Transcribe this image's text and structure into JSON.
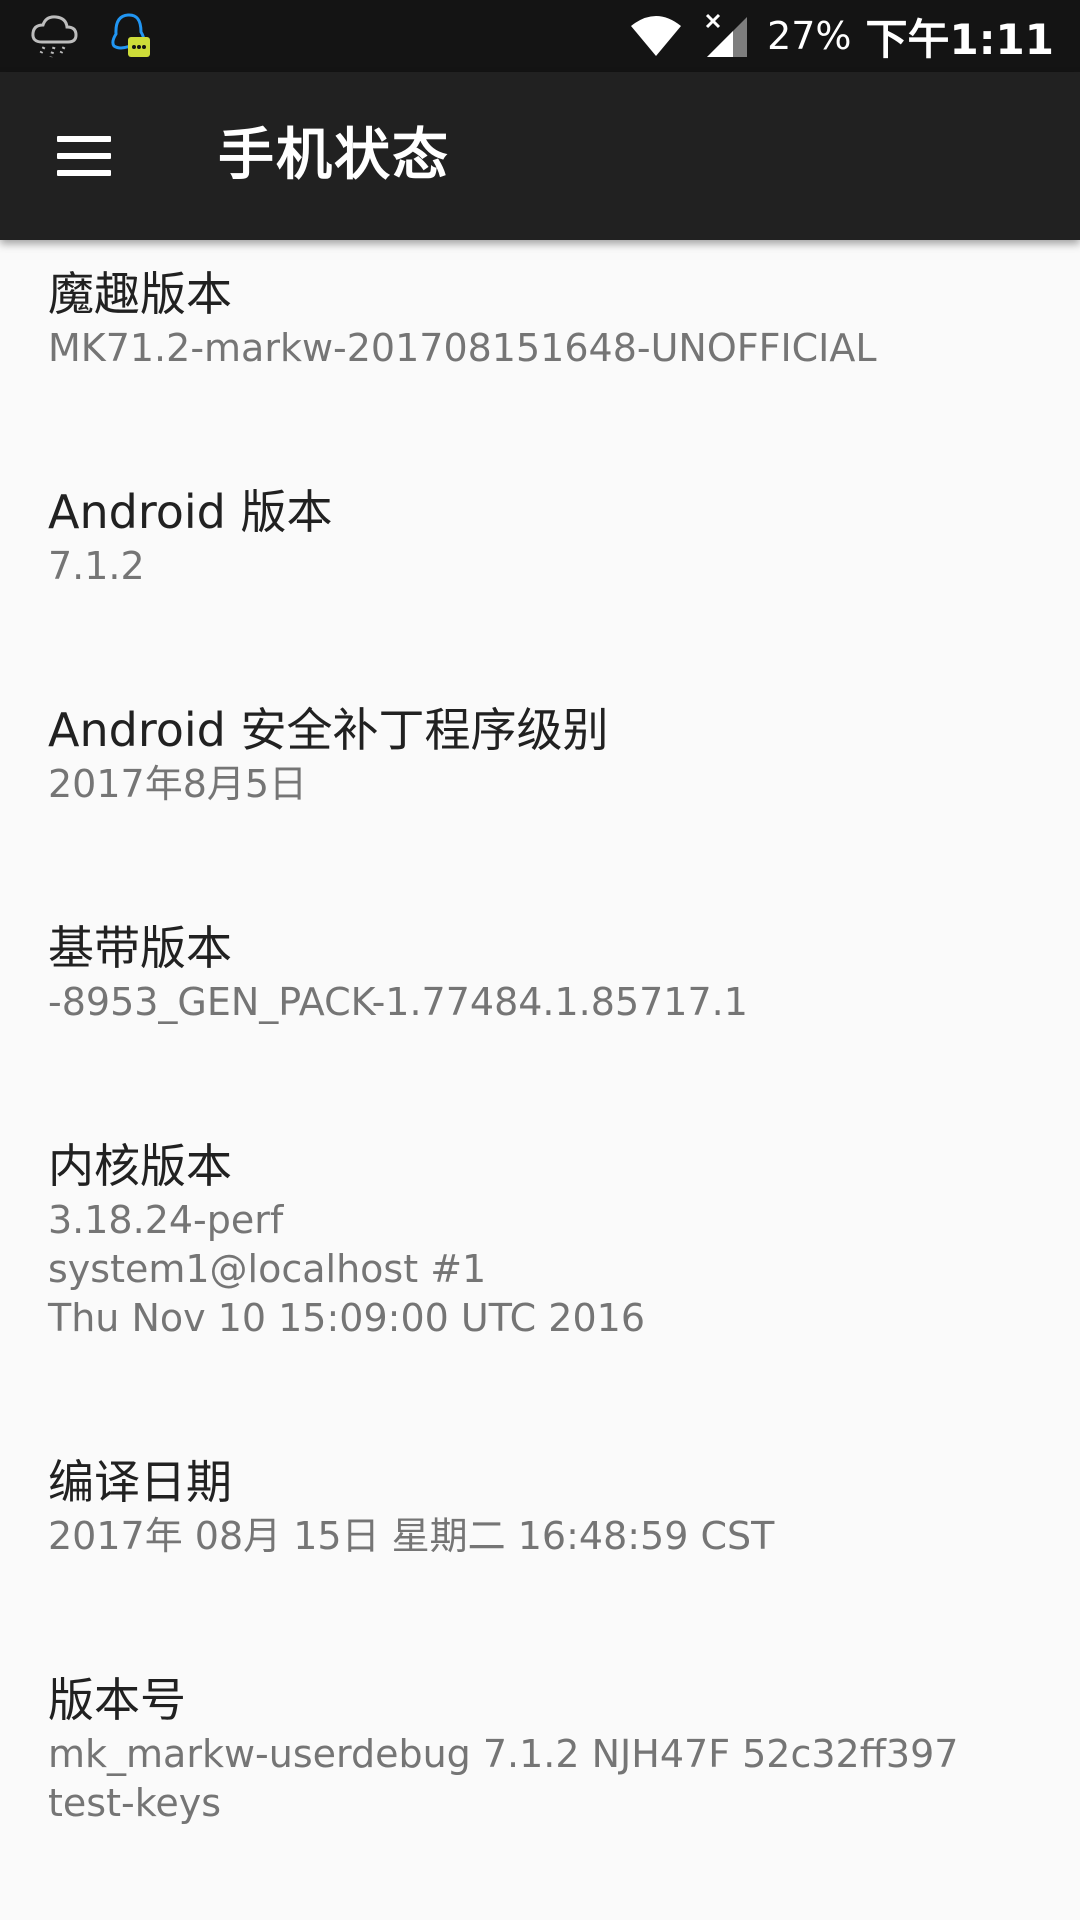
{
  "status_bar": {
    "left_icons": [
      "cloud-rain-icon",
      "qq-message-icon"
    ],
    "right_icons": [
      "wifi-icon",
      "no-sim-signal-icon"
    ],
    "battery": "27%",
    "time": "下午1:11"
  },
  "app_bar": {
    "menu_icon": "hamburger-menu-icon",
    "title": "手机状态"
  },
  "items": [
    {
      "title": "魔趣版本",
      "summary": [
        "MK71.2-markw-201708151648-UNOFFICIAL"
      ]
    },
    {
      "title": "Android 版本",
      "summary": [
        "7.1.2"
      ]
    },
    {
      "title": "Android 安全补丁程序级别",
      "summary": [
        "2017年8月5日"
      ]
    },
    {
      "title": "基带版本",
      "summary": [
        "-8953_GEN_PACK-1.77484.1.85717.1"
      ]
    },
    {
      "title": "内核版本",
      "summary": [
        "3.18.24-perf",
        "system1@localhost #1",
        "Thu Nov 10 15:09:00 UTC 2016"
      ]
    },
    {
      "title": "编译日期",
      "summary": [
        "2017年 08月 15日 星期二 16:48:59 CST"
      ]
    },
    {
      "title": "版本号",
      "summary": [
        "mk_markw-userdebug 7.1.2 NJH47F 52c32ff397",
        "test-keys"
      ]
    }
  ]
}
